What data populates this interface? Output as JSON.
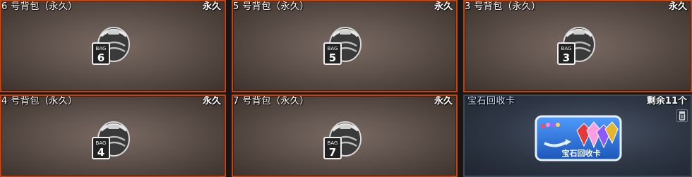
{
  "items": [
    {
      "title": "6 号背包（永久）",
      "duration": "永久",
      "bag_number": "6",
      "bag_text": "BAG",
      "icon": "backpack-icon"
    },
    {
      "title": "5 号背包（永久）",
      "duration": "永久",
      "bag_number": "5",
      "bag_text": "BAG",
      "icon": "backpack-icon"
    },
    {
      "title": "3 号背包（永久）",
      "duration": "永久",
      "bag_number": "3",
      "bag_text": "BAG",
      "icon": "backpack-icon"
    },
    {
      "title": "4 号背包（永久）",
      "duration": "永久",
      "bag_number": "4",
      "bag_text": "BAG",
      "icon": "backpack-icon"
    },
    {
      "title": "7 号背包（永久）",
      "duration": "永久",
      "bag_number": "7",
      "bag_text": "BAG",
      "icon": "backpack-icon"
    }
  ],
  "gem_card": {
    "title": "宝石回收卡",
    "remaining": "剩余11个",
    "card_label": "宝石回收卡",
    "icon": "gem-recycle-card-icon",
    "action_icon": "trash-icon"
  },
  "colors": {
    "bag_border": "#b8471a",
    "gem_border": "#3f4a58",
    "card_blue": "#2a6fd6"
  }
}
